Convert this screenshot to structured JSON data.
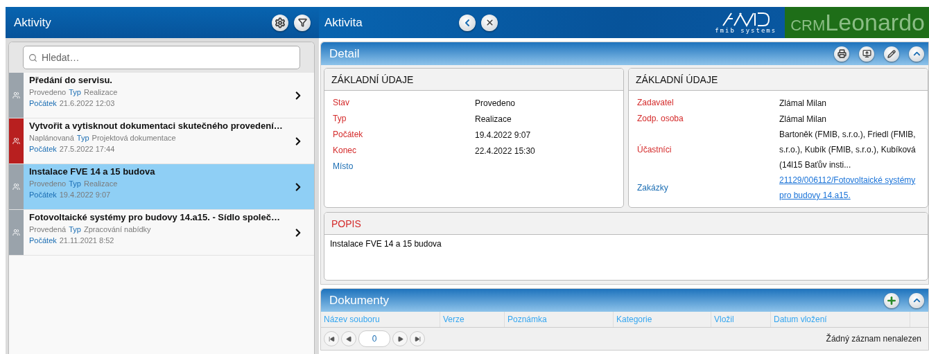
{
  "left": {
    "title": "Aktivity",
    "search": {
      "placeholder": "Hledat…"
    },
    "items": [
      {
        "title": "Předání do servisu.",
        "status": "Provedeno",
        "type_label": "Typ",
        "type": "Realizace",
        "start_label": "Počátek",
        "start": "21.6.2022 12:03",
        "color": "#9aa3ab",
        "selected": false
      },
      {
        "title": "Vytvořit a vytisknout dokumentaci skutečného provedení…",
        "status": "Naplánovaná",
        "type_label": "Typ",
        "type": "Projektová dokumentace",
        "start_label": "Počátek",
        "start": "27.5.2022 17:44",
        "color": "#b81f1f",
        "selected": false
      },
      {
        "title": "Instalace FVE 14 a 15 budova",
        "status": "Provedeno",
        "type_label": "Typ",
        "type": "Realizace",
        "start_label": "Počátek",
        "start": "19.4.2022 9:07",
        "color": "#9aa3ab",
        "selected": true
      },
      {
        "title": "Fotovoltaické systémy pro budovy 14.a15. - Sídlo společ…",
        "status": "Provedená",
        "type_label": "Typ",
        "type": "Zpracování nabídky",
        "start_label": "Počátek",
        "start": "21.11.2021 8:52",
        "color": "#9aa3ab",
        "selected": false
      }
    ]
  },
  "right": {
    "title": "Aktivita",
    "logo": {
      "company": "fmib systems",
      "prefix": "CRM",
      "product": "Leonardo"
    },
    "detail": {
      "title": "Detail",
      "cards": [
        {
          "title": "ZÁKLADNÍ ÚDAJE",
          "rows": [
            {
              "label": "Stav",
              "value": "Provedeno",
              "required": true
            },
            {
              "label": "Typ",
              "value": "Realizace",
              "required": true
            },
            {
              "label": "Počátek",
              "value": "19.4.2022 9:07",
              "required": true
            },
            {
              "label": "Konec",
              "value": "22.4.2022 15:30",
              "required": true
            },
            {
              "label": "Místo",
              "required": false
            }
          ]
        },
        {
          "title": "ZÁKLADNÍ ÚDAJE",
          "rows": [
            {
              "label": "Zadavatel",
              "value": "Zlámal Milan",
              "required": true
            },
            {
              "label": "Zodp. osoba",
              "value": "Zlámal Milan",
              "required": true
            },
            {
              "label": "Účastníci",
              "value": "Bartoněk (FMIB, s.r.o.), Friedl (FMIB, s.r.o.), Kubík (FMIB, s.r.o.), Kubíková (14l15 Baťův insti...",
              "required": true
            },
            {
              "label": "Zakázky",
              "value": "21129/006112/Fotovoltaické systémy pro budovy 14.a15.",
              "link": true,
              "required": false
            }
          ]
        }
      ],
      "description": {
        "title": "POPIS",
        "text": "Instalace FVE 14 a 15 budova"
      }
    },
    "documents": {
      "title": "Dokumenty",
      "columns": [
        "Název souboru",
        "Verze",
        "Poznámka",
        "Kategorie",
        "Vložil",
        "Datum vložení"
      ],
      "pager": {
        "page": "0",
        "status": "Žádný záznam nenalezen"
      }
    }
  }
}
